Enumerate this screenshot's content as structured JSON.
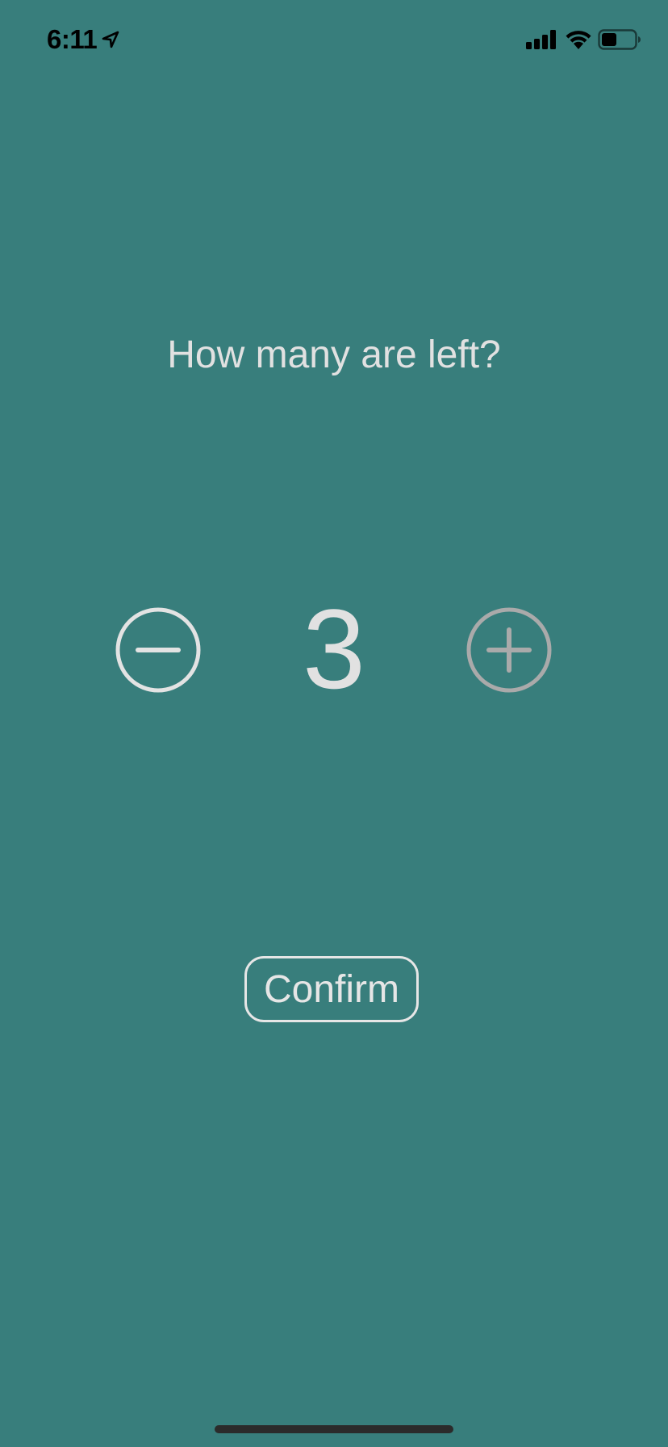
{
  "status_bar": {
    "time": "6:11",
    "icons": [
      "location-arrow-icon",
      "cellular-signal-icon",
      "wifi-icon",
      "battery-icon"
    ]
  },
  "prompt": {
    "question": "How many are left?"
  },
  "stepper": {
    "value": "3",
    "decrement_icon": "minus-circle-icon",
    "increment_icon": "plus-circle-icon"
  },
  "actions": {
    "confirm_label": "Confirm"
  },
  "colors": {
    "background": "#387e7c",
    "foreground": "#e1e1e1",
    "increment_disabled": "#aaaaaa"
  }
}
